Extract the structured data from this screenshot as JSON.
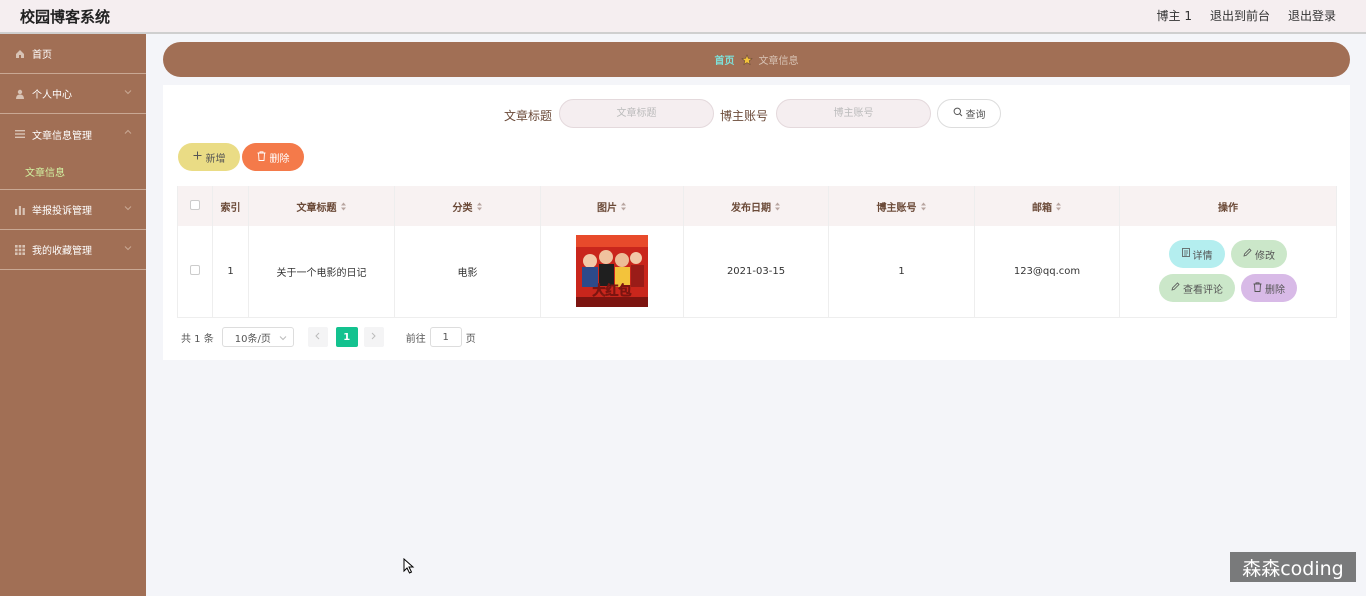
{
  "header": {
    "title": "校园博客系统",
    "user": "博主 1",
    "back_front": "退出到前台",
    "logout": "退出登录"
  },
  "sidebar": {
    "items": [
      {
        "label": "首页",
        "icon": "home-icon"
      },
      {
        "label": "个人中心",
        "icon": "user-icon"
      },
      {
        "label": "文章信息管理",
        "icon": "list-icon"
      },
      {
        "label": "文章信息",
        "sub": true
      },
      {
        "label": "举报投诉管理",
        "icon": "chart-icon"
      },
      {
        "label": "我的收藏管理",
        "icon": "grid-icon"
      }
    ]
  },
  "breadcrumb": {
    "home": "首页",
    "current": "文章信息"
  },
  "search": {
    "title_label": "文章标题",
    "title_placeholder": "文章标题",
    "account_label": "博主账号",
    "account_placeholder": "博主账号",
    "query": "查询"
  },
  "toolbar": {
    "add": "新增",
    "delete": "删除"
  },
  "table": {
    "headers": [
      "索引",
      "文章标题",
      "分类",
      "图片",
      "发布日期",
      "博主账号",
      "邮箱",
      "操作"
    ],
    "rows": [
      {
        "index": "1",
        "title": "关于一个电影的日记",
        "category": "电影",
        "date": "2021-03-15",
        "account": "1",
        "email": "123@qq.com",
        "poster_text": "大红包"
      }
    ],
    "actions": {
      "detail": "详情",
      "edit": "修改",
      "comments": "查看评论",
      "delete": "删除"
    }
  },
  "pagination": {
    "total": "共 1 条",
    "page_size": "10条/页",
    "current_page": "1",
    "goto_label": "前往",
    "goto_value": "1",
    "page_unit": "页"
  },
  "watermark": "森森coding",
  "colors": {
    "sidebar": "#a16f55",
    "accent_green": "#13c28f",
    "add_btn": "#eadc85",
    "delete_btn": "#f47a4a"
  }
}
